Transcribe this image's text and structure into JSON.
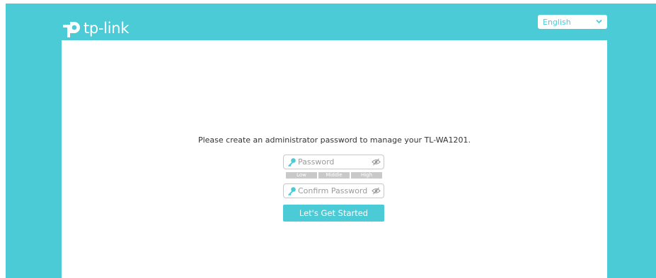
{
  "brand": {
    "logo_text": "tp-link"
  },
  "language": {
    "selected": "English"
  },
  "setup": {
    "prompt": "Please create an administrator password to manage your TL-WA1201.",
    "password_placeholder": "Password",
    "confirm_placeholder": "Confirm Password",
    "strength_levels": [
      "Low",
      "Middle",
      "High"
    ],
    "start_button": "Let's Get Started"
  },
  "colors": {
    "brand_teal": "#4acbd6",
    "strength_inactive": "#c9c9c9"
  },
  "icons": {
    "field_icon": "key-icon",
    "toggle_icon": "eye-slash-icon",
    "dropdown_icon": "chevron-down-icon"
  }
}
